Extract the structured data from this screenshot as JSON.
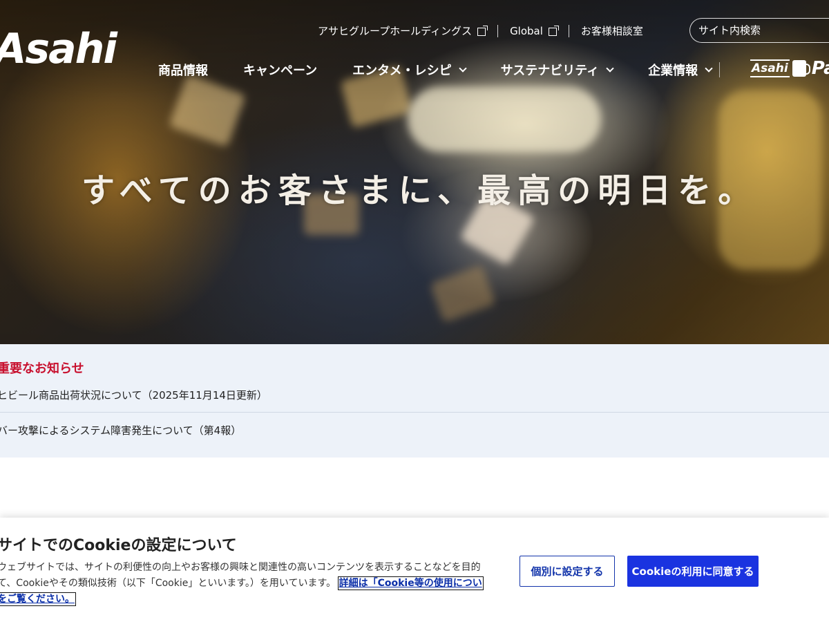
{
  "header": {
    "logo_text": "Asahi",
    "util_links": [
      {
        "label": "アサヒグループホールディングス",
        "icon": "external-link-icon"
      },
      {
        "label": "Global",
        "icon": "external-link-icon"
      },
      {
        "label": "お客様相談室"
      }
    ],
    "search_placeholder": "サイト内検索",
    "nav": [
      {
        "label": "商品情報"
      },
      {
        "label": "キャンペーン"
      },
      {
        "label": "エンタメ・レシピ",
        "icon": "chevron-down-icon"
      },
      {
        "label": "サステナビリティ",
        "icon": "chevron-down-icon"
      },
      {
        "label": "企業情報",
        "icon": "chevron-down-icon"
      }
    ],
    "brand_banner": {
      "small": "Asahi",
      "big": "Pa"
    }
  },
  "hero": {
    "tagline": "すべてのお客さまに、最高の明日を。"
  },
  "notices": {
    "title": "重要なお知らせ",
    "items": [
      "ヒビール商品出荷状況について（2025年11月14日更新）",
      "バー攻撃によるシステム障害発生について（第4報）"
    ]
  },
  "cookie": {
    "title": "サイトでのCookieの設定について",
    "text_line1": "ウェブサイトでは、サイトの利便性の向上やお客様の興味と関連性の高いコンテンツを表示することなどを目的",
    "text_line2": "て、Cookieやその類似技術（以下「Cookie」といいます。）を用いています。",
    "link_text": "詳細は「Cookie等の使用につい",
    "link_text2": "をご覧ください。",
    "btn_settings": "個別に設定する",
    "btn_accept": "Cookieの利用に同意する"
  },
  "colors": {
    "notice_title": "#c8102e",
    "notice_bg": "#edf2f9",
    "primary_button": "#1a33e0",
    "link": "#0a2ea8"
  }
}
